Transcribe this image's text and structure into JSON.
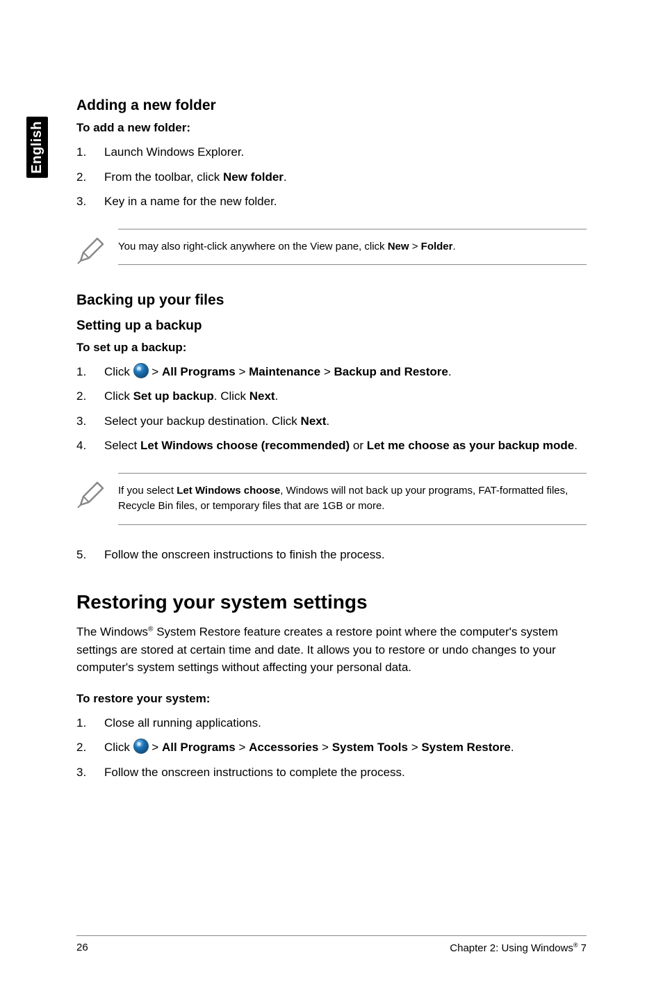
{
  "sidetab": "English",
  "s1": {
    "heading": "Adding a new folder",
    "sub": "To add a new folder:",
    "items": [
      {
        "n": "1.",
        "t": "Launch Windows Explorer."
      },
      {
        "n": "2.",
        "pre": "From the toolbar, click ",
        "b": "New folder",
        "post": "."
      },
      {
        "n": "3.",
        "t": "Key in a name for the new folder."
      }
    ],
    "note_pre": "You may also right-click anywhere on the View pane, click ",
    "note_b1": "New",
    "note_mid": " > ",
    "note_b2": "Folder",
    "note_post": "."
  },
  "s2": {
    "heading": "Backing up your files",
    "sub": "Setting up a backup",
    "sub2": "To set up a backup:",
    "i1": {
      "n": "1.",
      "pre": "Click ",
      "b1": "All Programs",
      "b2": "Maintenance",
      "b3": "Backup and Restore"
    },
    "i2": {
      "n": "2.",
      "pre": "Click ",
      "b1": "Set up backup",
      "mid": ". Click ",
      "b2": "Next",
      "post": "."
    },
    "i3": {
      "n": "3.",
      "pre": "Select your backup destination. Click ",
      "b1": "Next",
      "post": "."
    },
    "i4": {
      "n": "4.",
      "pre": "Select ",
      "b1": "Let Windows choose (recommended)",
      "mid": " or ",
      "b2": "Let me choose as your backup mode",
      "post": "."
    },
    "note_pre": "If you select ",
    "note_b": "Let Windows choose",
    "note_post": ", Windows will not back up your programs, FAT-formatted files, Recycle Bin files, or temporary files that are 1GB or more.",
    "i5": {
      "n": "5.",
      "t": "Follow the onscreen instructions to finish the process."
    }
  },
  "s3": {
    "heading": "Restoring your system settings",
    "para_pre": "The Windows",
    "para_sup": "®",
    "para_post": " System Restore feature creates a restore point where the computer's system settings are stored at certain time and date. It allows you to restore or undo changes to your computer's system settings without affecting your personal data.",
    "sub": "To restore your system:",
    "i1": {
      "n": "1.",
      "t": "Close all running applications."
    },
    "i2": {
      "n": "2.",
      "pre": "Click ",
      "b1": "All Programs",
      "b2": "Accessories",
      "b3": "System Tools",
      "b4": "System Restore"
    },
    "i3": {
      "n": "3.",
      "t": "Follow the onscreen instructions to complete the process."
    }
  },
  "footer": {
    "page": "26",
    "chapter_pre": "Chapter 2: Using Windows",
    "chapter_sup": "®",
    "chapter_post": " 7"
  }
}
